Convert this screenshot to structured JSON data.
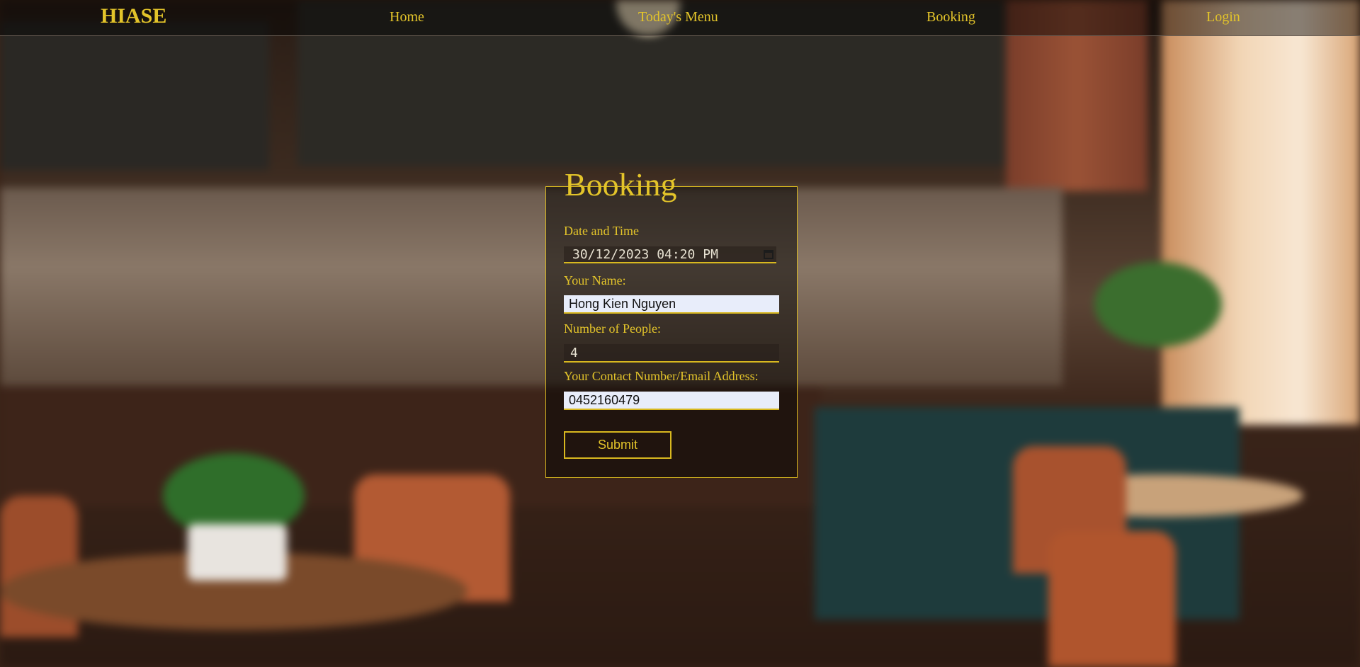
{
  "nav": {
    "brand": "HIASE",
    "links": [
      "Home",
      "Today's Menu",
      "Booking",
      "Login"
    ]
  },
  "booking": {
    "title": "Booking",
    "date_label": "Date and Time",
    "date_value": "30/12/2023 04:20 PM",
    "name_label": "Your Name:",
    "name_value": "Hong Kien Nguyen",
    "people_label": "Number of People:",
    "people_value": "4",
    "contact_label": "Your Contact Number/Email Address:",
    "contact_value": "0452160479",
    "submit_label": "Submit"
  },
  "colors": {
    "accent": "#e3c42a",
    "border": "#d8b81f",
    "input_bg": "#e8edfa"
  },
  "icons": {
    "date_picker": "calendar-icon"
  }
}
